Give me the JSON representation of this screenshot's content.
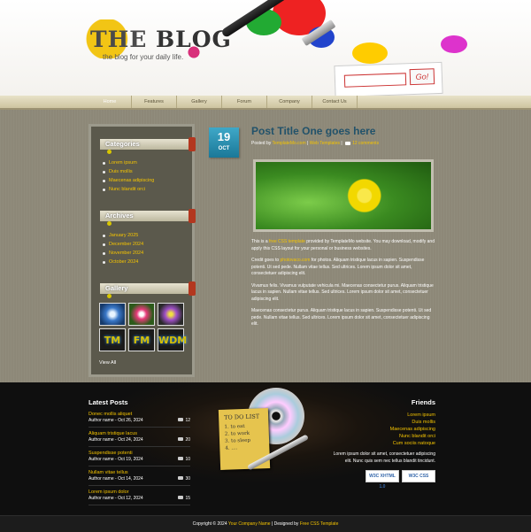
{
  "header": {
    "logo_title_first": "THE",
    "logo_title_rest": " BLOG",
    "tagline": "the blog for your daily life.",
    "go_label": "Go!"
  },
  "nav": {
    "items": [
      {
        "label": "Home",
        "active": true
      },
      {
        "label": "Features"
      },
      {
        "label": "Gallery"
      },
      {
        "label": "Forum"
      },
      {
        "label": "Company"
      },
      {
        "label": "Contact Us"
      }
    ]
  },
  "sidebar": {
    "categories_title": "Categories",
    "categories": [
      "Lorem ipsum",
      "Duis mollis",
      "Maecenas adipiscing",
      "Nunc blandit orci"
    ],
    "archives_title": "Archives",
    "archives": [
      "January 2025",
      "December 2024",
      "November 2024",
      "October 2024"
    ],
    "gallery_title": "Gallery",
    "gallery_words": [
      "TM",
      "FM",
      "WDM"
    ],
    "view_all": "View All"
  },
  "post": {
    "date_day": "19",
    "date_month": "OCT",
    "title": "Post Title One goes here",
    "meta_prefix": "Posted by ",
    "meta_author": "TemplateMo.com",
    "meta_sep1": " | ",
    "meta_category": "Web Templates",
    "meta_sep2": " | ",
    "meta_comments": "12 comments",
    "p1_a": "This is a ",
    "p1_link": "free CSS template",
    "p1_b": " provided by TemplateMo website. You may download, modify and apply this CSS layout for your personal or business websites.",
    "p2_a": "Credit goes to ",
    "p2_link": "photovaco.com",
    "p2_b": " for photos. Aliquam tristique lacus in sapien. Suspendisse potenti. Ut sed pede. Nullam vitae tellus. Sed ultrices. Lorem ipsum dolor sit amet, consectetuer adipiscing elit.",
    "p3": "Vivamus felis. Vivamus vulputate vehicula mi. Maecenas consectetur purus. Aliquam tristique lacus in sapien. Nullam vitae tellus. Sed ultrices. Lorem ipsum dolor sit amet, consectetuer adipiscing elit.",
    "p4": "Maecenas consectetur purus. Aliquam tristique lacus in sapien. Suspendisse potenti. Ut sed pede. Nullam vitae tellus. Sed ultrices. Lorem ipsum dolor sit amet, consectetuer adipiscing elit."
  },
  "footer": {
    "latest_title": "Latest Posts",
    "latest_posts": [
      {
        "title": "Donec mollis aliquet",
        "meta": "Author name - Oct 26, 2024",
        "count": "12"
      },
      {
        "title": "Aliquam tristique lacus",
        "meta": "Author name - Oct 24, 2024",
        "count": "20"
      },
      {
        "title": "Suspendisse potenti",
        "meta": "Author name - Oct 19, 2024",
        "count": "10"
      },
      {
        "title": "Nullam vitae tellus",
        "meta": "Author name - Oct 14, 2024",
        "count": "30"
      },
      {
        "title": "Lorem ipsum dolor",
        "meta": "Author name - Oct 12, 2024",
        "count": "15"
      }
    ],
    "todo_title": "TO DO LIST",
    "todo_items": [
      "1. to eat",
      "2. to work",
      "3. to sleep",
      "4. ...."
    ],
    "friends_title": "Friends",
    "friends": [
      "Lorem ipsum",
      "Duis mollis",
      "Maecenas adipiscing",
      "Nunc blandit orci",
      "Cum sociis natoque"
    ],
    "friends_text": "Lorem ipsum dolor sit amet, consectetuer adipiscing elit. Nunc quis sem nec tellus blandit tincidunt.",
    "badge_xhtml": "W3C XHTML 1.0",
    "badge_css": "W3C CSS"
  },
  "copyright": {
    "prefix": "Copyright © 2024 ",
    "company": "Your Company Name",
    "middle": " | Designed by ",
    "designer": "Free CSS Template"
  },
  "colors": {
    "accent_yellow": "#f5c400",
    "title_blue": "#22526a",
    "badge_blue": "#1a7898"
  }
}
